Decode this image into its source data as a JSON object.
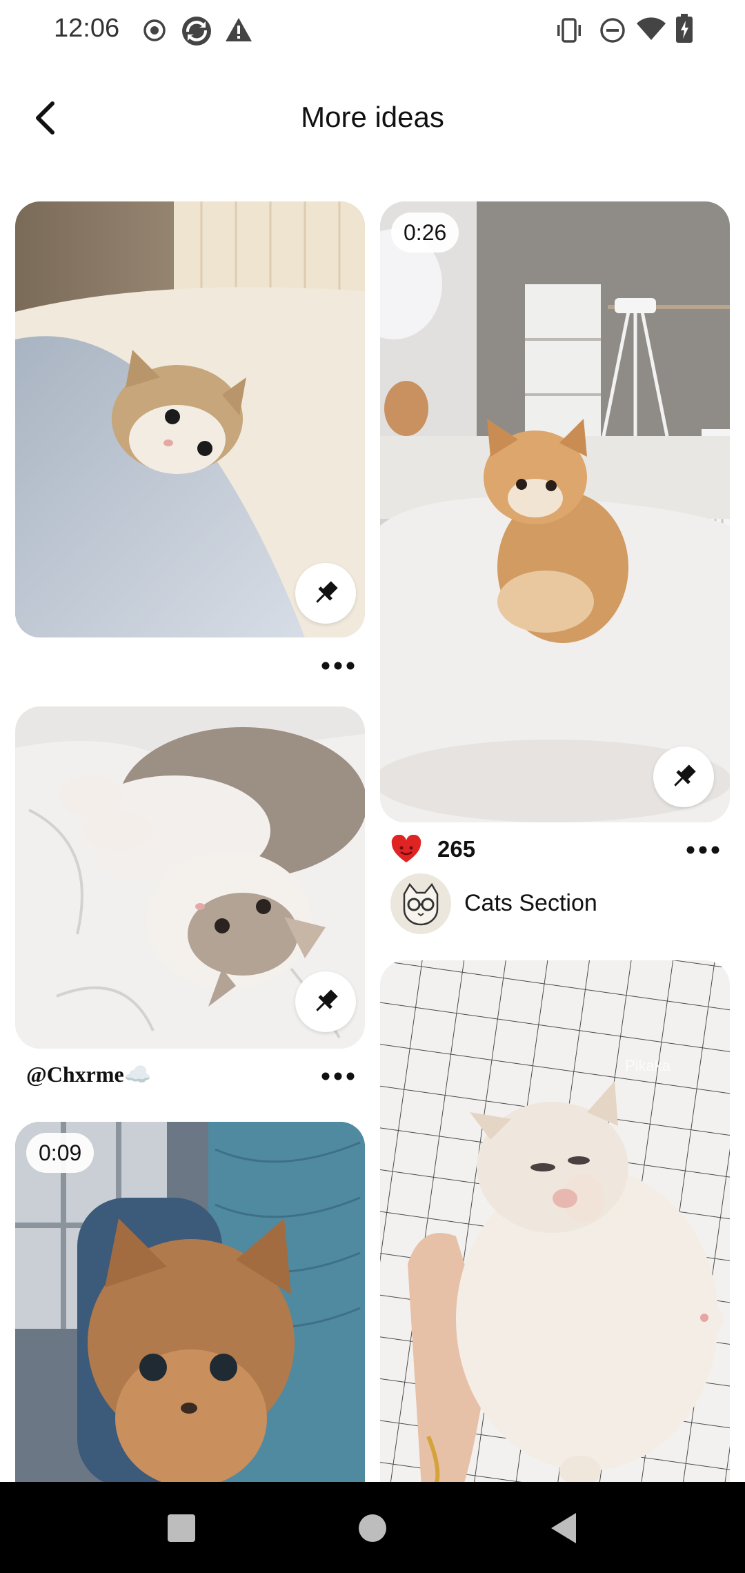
{
  "status_bar": {
    "time": "12:06",
    "left_icons": [
      "record-icon",
      "sync-app-icon",
      "warning-icon"
    ],
    "right_icons": [
      "vibrate-icon",
      "dnd-icon",
      "wifi-icon",
      "battery-charging-icon"
    ]
  },
  "header": {
    "title": "More ideas",
    "back_icon": "chevron-left-icon"
  },
  "pins": [
    {
      "id": "kitten-bed",
      "image": "kitten-peeking-from-blanket",
      "save_icon": "pushpin-icon",
      "more_icon": "more-horizontal-icon"
    },
    {
      "id": "kitten-video-bed",
      "image": "orange-kitten-sitting-on-bed",
      "duration": "0:26",
      "save_icon": "pushpin-icon",
      "likes": "265",
      "heart_icon": "heart-icon",
      "board": "Cats Section",
      "more_icon": "more-horizontal-icon"
    },
    {
      "id": "kitten-lying",
      "image": "kitten-lying-on-white-sheets",
      "author": "@Chxrme☁️",
      "save_icon": "pushpin-icon",
      "more_icon": "more-horizontal-icon"
    },
    {
      "id": "kitten-window",
      "image": "orange-kitten-by-window",
      "duration": "0:09"
    },
    {
      "id": "kitten-hand",
      "image": "white-kitten-in-hand-on-grid-sheet"
    }
  ],
  "nav_bar": {
    "buttons": [
      "recents-square-icon",
      "home-circle-icon",
      "back-triangle-icon"
    ]
  },
  "colors": {
    "heart": "#e02424",
    "background": "#ffffff",
    "text": "#111111",
    "nav_background": "#000000"
  }
}
